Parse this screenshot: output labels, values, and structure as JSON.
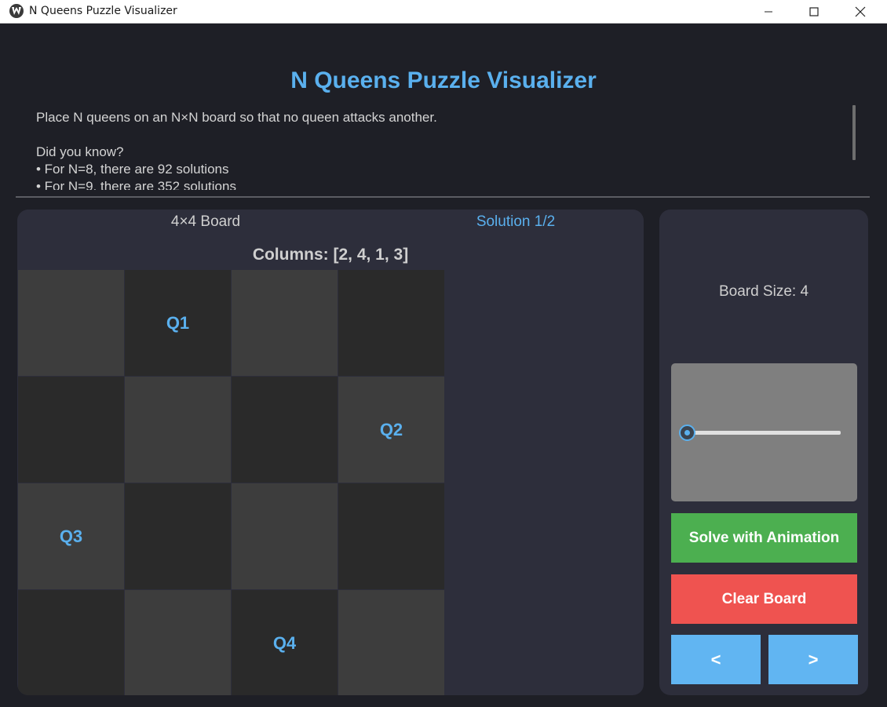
{
  "window": {
    "title": "N Queens Puzzle Visualizer"
  },
  "header": {
    "title": "N Queens Puzzle Visualizer",
    "info_lines": [
      "Place N queens on an N×N board so that no queen attacks another.",
      "",
      "Did you know?",
      "• For N=8, there are 92 solutions",
      "• For N=9, there are 352 solutions"
    ]
  },
  "board": {
    "label": "4×4 Board",
    "solution_label": "Solution 1/2",
    "columns_label": "Columns: [2, 4, 1, 3]",
    "cells": [
      [
        "",
        "Q1",
        "",
        ""
      ],
      [
        "",
        "",
        "",
        "Q2"
      ],
      [
        "Q3",
        "",
        "",
        ""
      ],
      [
        "",
        "",
        "Q4",
        ""
      ]
    ]
  },
  "controls": {
    "size_label": "Board Size: 4",
    "slider_value": 4,
    "solve_label": "Solve with Animation",
    "clear_label": "Clear Board",
    "prev_label": "<",
    "next_label": ">"
  },
  "colors": {
    "accent": "#5ab0ee",
    "solve": "#4caf50",
    "clear": "#ef5350",
    "nav": "#61b5f2"
  }
}
